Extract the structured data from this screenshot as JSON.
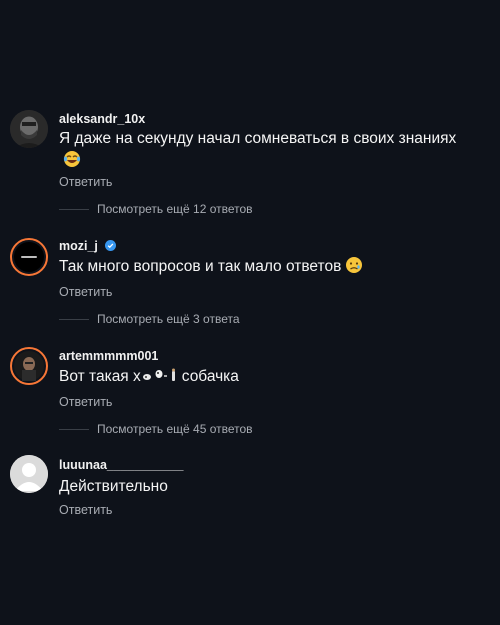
{
  "comments": [
    {
      "username": "aleksandr_10x",
      "text": "Я даже на секунду начал сомневаться в своих знаниях",
      "emoji": "laughing-tears-emoji",
      "reply_label": "Ответить",
      "more_replies": "Посмотреть ещё 12 ответов"
    },
    {
      "username": "mozi_j",
      "verified": true,
      "text": "Так много вопросов и так мало ответов",
      "emoji": "sad-face-emoji",
      "reply_label": "Ответить",
      "more_replies": "Посмотреть ещё 3 ответа"
    },
    {
      "username": "artemmmmm001",
      "text_before": "Вот такая х",
      "text_after": "собачка",
      "emoji": "dog-sticker-emojis",
      "reply_label": "Ответить",
      "more_replies": "Посмотреть ещё 45 ответов"
    },
    {
      "username": "luuunaa___________",
      "text": "Действительно",
      "reply_label": "Ответить"
    }
  ],
  "colors": {
    "background": "#0e121a",
    "text": "#f5f5f5",
    "secondary_text": "#a8acb3",
    "verified": "#3797f0",
    "story_ring": "#f77737"
  }
}
